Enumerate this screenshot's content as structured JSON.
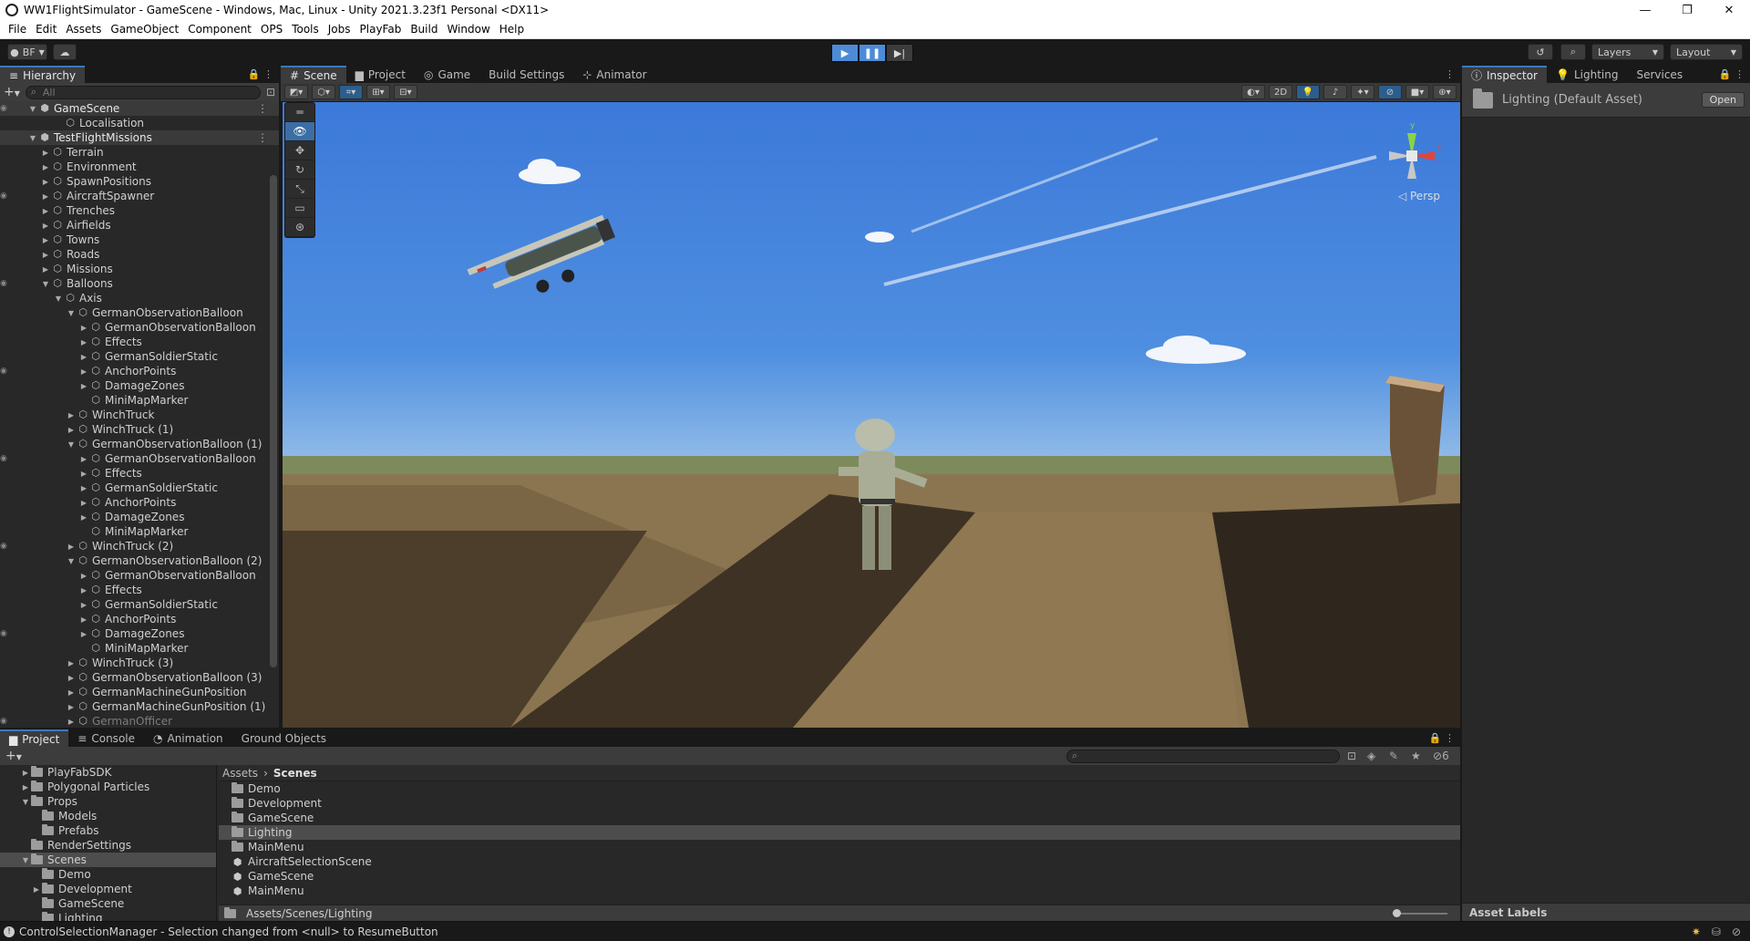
{
  "window": {
    "title": "WW1FlightSimulator - GameScene - Windows, Mac, Linux - Unity 2021.3.23f1 Personal <DX11>",
    "minimize": "—",
    "maximize": "❐",
    "close": "✕"
  },
  "menu": [
    "File",
    "Edit",
    "Assets",
    "GameObject",
    "Component",
    "OPS",
    "Tools",
    "Jobs",
    "PlayFab",
    "Build",
    "Window",
    "Help"
  ],
  "toolbar": {
    "account": "BF",
    "layers": "Layers",
    "layout": "Layout"
  },
  "hierarchy": {
    "tab": "Hierarchy",
    "search_placeholder": "All",
    "rows": [
      {
        "label": "GameScene",
        "depth": 0,
        "arrow": "▼",
        "scene": true
      },
      {
        "label": "Localisation",
        "depth": 2,
        "arrow": "",
        "dim": false
      },
      {
        "label": "TestFlightMissions",
        "depth": 0,
        "arrow": "▼",
        "scene": true
      },
      {
        "label": "Terrain",
        "depth": 1,
        "arrow": "▶"
      },
      {
        "label": "Environment",
        "depth": 1,
        "arrow": "▶"
      },
      {
        "label": "SpawnPositions",
        "depth": 1,
        "arrow": "▶"
      },
      {
        "label": "AircraftSpawner",
        "depth": 1,
        "arrow": "▶"
      },
      {
        "label": "Trenches",
        "depth": 1,
        "arrow": "▶"
      },
      {
        "label": "Airfields",
        "depth": 1,
        "arrow": "▶"
      },
      {
        "label": "Towns",
        "depth": 1,
        "arrow": "▶"
      },
      {
        "label": "Roads",
        "depth": 1,
        "arrow": "▶"
      },
      {
        "label": "Missions",
        "depth": 1,
        "arrow": "▶"
      },
      {
        "label": "Balloons",
        "depth": 1,
        "arrow": "▼"
      },
      {
        "label": "Axis",
        "depth": 2,
        "arrow": "▼"
      },
      {
        "label": "GermanObservationBalloon",
        "depth": 3,
        "arrow": "▼"
      },
      {
        "label": "GermanObservationBalloon",
        "depth": 4,
        "arrow": "▶"
      },
      {
        "label": "Effects",
        "depth": 4,
        "arrow": "▶"
      },
      {
        "label": "GermanSoldierStatic",
        "depth": 4,
        "arrow": "▶"
      },
      {
        "label": "AnchorPoints",
        "depth": 4,
        "arrow": "▶"
      },
      {
        "label": "DamageZones",
        "depth": 4,
        "arrow": "▶"
      },
      {
        "label": "MiniMapMarker",
        "depth": 4,
        "arrow": ""
      },
      {
        "label": "WinchTruck",
        "depth": 3,
        "arrow": "▶"
      },
      {
        "label": "WinchTruck (1)",
        "depth": 3,
        "arrow": "▶"
      },
      {
        "label": "GermanObservationBalloon (1)",
        "depth": 3,
        "arrow": "▼"
      },
      {
        "label": "GermanObservationBalloon",
        "depth": 4,
        "arrow": "▶"
      },
      {
        "label": "Effects",
        "depth": 4,
        "arrow": "▶"
      },
      {
        "label": "GermanSoldierStatic",
        "depth": 4,
        "arrow": "▶"
      },
      {
        "label": "AnchorPoints",
        "depth": 4,
        "arrow": "▶"
      },
      {
        "label": "DamageZones",
        "depth": 4,
        "arrow": "▶"
      },
      {
        "label": "MiniMapMarker",
        "depth": 4,
        "arrow": ""
      },
      {
        "label": "WinchTruck (2)",
        "depth": 3,
        "arrow": "▶"
      },
      {
        "label": "GermanObservationBalloon (2)",
        "depth": 3,
        "arrow": "▼"
      },
      {
        "label": "GermanObservationBalloon",
        "depth": 4,
        "arrow": "▶"
      },
      {
        "label": "Effects",
        "depth": 4,
        "arrow": "▶"
      },
      {
        "label": "GermanSoldierStatic",
        "depth": 4,
        "arrow": "▶"
      },
      {
        "label": "AnchorPoints",
        "depth": 4,
        "arrow": "▶"
      },
      {
        "label": "DamageZones",
        "depth": 4,
        "arrow": "▶"
      },
      {
        "label": "MiniMapMarker",
        "depth": 4,
        "arrow": ""
      },
      {
        "label": "WinchTruck (3)",
        "depth": 3,
        "arrow": "▶"
      },
      {
        "label": "GermanObservationBalloon (3)",
        "depth": 3,
        "arrow": "▶"
      },
      {
        "label": "GermanMachineGunPosition",
        "depth": 3,
        "arrow": "▶"
      },
      {
        "label": "GermanMachineGunPosition (1)",
        "depth": 3,
        "arrow": "▶"
      },
      {
        "label": "GermanOfficer",
        "depth": 3,
        "arrow": "▶",
        "dim": true
      }
    ]
  },
  "scene_tabs": [
    {
      "label": "Scene",
      "icon": "#",
      "active": true
    },
    {
      "label": "Project",
      "icon": "▆",
      "active": false
    },
    {
      "label": "Game",
      "icon": "◎",
      "active": false
    },
    {
      "label": "Build Settings",
      "icon": "",
      "active": false
    },
    {
      "label": "Animator",
      "icon": "⊹",
      "active": false
    }
  ],
  "scene": {
    "mode_2d": "2D",
    "persp": "◁ Persp",
    "axis_y": "y",
    "axis_x": "x"
  },
  "inspector": {
    "tabs": [
      {
        "label": "Inspector",
        "icon": "ⓘ",
        "active": true
      },
      {
        "label": "Lighting",
        "icon": "💡",
        "active": false
      },
      {
        "label": "Services",
        "icon": "",
        "active": false
      }
    ],
    "asset_name": "Lighting (Default Asset)",
    "open_button": "Open",
    "asset_labels": "Asset Labels"
  },
  "project": {
    "tabs": [
      {
        "label": "Project",
        "icon": "▆",
        "active": true
      },
      {
        "label": "Console",
        "icon": "≡",
        "active": false
      },
      {
        "label": "Animation",
        "icon": "◔",
        "active": false
      },
      {
        "label": "Ground Objects",
        "icon": "",
        "active": false
      }
    ],
    "hidden_count": "6",
    "tree": [
      {
        "label": "PlayFabSDK",
        "depth": 1,
        "arrow": "▶"
      },
      {
        "label": "Polygonal Particles",
        "depth": 1,
        "arrow": "▶"
      },
      {
        "label": "Props",
        "depth": 1,
        "arrow": "▼"
      },
      {
        "label": "Models",
        "depth": 2,
        "arrow": ""
      },
      {
        "label": "Prefabs",
        "depth": 2,
        "arrow": ""
      },
      {
        "label": "RenderSettings",
        "depth": 1,
        "arrow": ""
      },
      {
        "label": "Scenes",
        "depth": 1,
        "arrow": "▼",
        "sel": true
      },
      {
        "label": "Demo",
        "depth": 2,
        "arrow": ""
      },
      {
        "label": "Development",
        "depth": 2,
        "arrow": "▶"
      },
      {
        "label": "GameScene",
        "depth": 2,
        "arrow": ""
      },
      {
        "label": "Lighting",
        "depth": 2,
        "arrow": ""
      }
    ],
    "breadcrumb": {
      "root": "Assets",
      "sep": "›",
      "current": "Scenes"
    },
    "files": [
      {
        "label": "Demo",
        "type": "folder"
      },
      {
        "label": "Development",
        "type": "folder"
      },
      {
        "label": "GameScene",
        "type": "folder"
      },
      {
        "label": "Lighting",
        "type": "folder",
        "sel": true
      },
      {
        "label": "MainMenu",
        "type": "folder"
      },
      {
        "label": "AircraftSelectionScene",
        "type": "scene"
      },
      {
        "label": "GameScene",
        "type": "scene"
      },
      {
        "label": "MainMenu",
        "type": "scene"
      }
    ],
    "path": "Assets/Scenes/Lighting"
  },
  "status": {
    "message": "ControlSelectionManager - Selection changed from <null> to ResumeButton"
  },
  "colors": {
    "accent": "#4d8bd6",
    "panel": "#282828",
    "header": "#3c3c3c"
  }
}
